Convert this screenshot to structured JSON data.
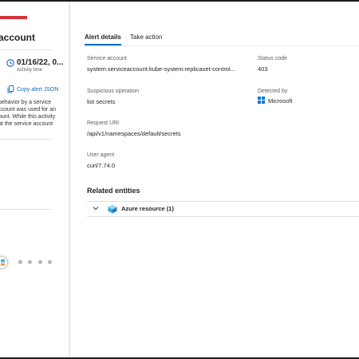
{
  "left_panel": {
    "title": "account",
    "activity_time": {
      "value": "01/16/22, 0...",
      "label": "Activity time"
    },
    "copy_alert_json": "Copy alert JSON",
    "description_lines": [
      "behavior by a service",
      "ccount was used for an",
      "ount. While this activity",
      "at the service account"
    ],
    "stepper": {
      "dots": 4
    }
  },
  "tabs": [
    {
      "label": "Alert details",
      "active": true
    },
    {
      "label": "Take action",
      "active": false
    }
  ],
  "details": {
    "service_account": {
      "label": "Service account",
      "value": "system:serviceaccount:kube-system:replicaset-control..."
    },
    "status_code": {
      "label": "Status code",
      "value": "403"
    },
    "suspicious_operation": {
      "label": "Suspicious operation",
      "value": "list secrets"
    },
    "detected_by": {
      "label": "Detected by",
      "value": "Microsoft"
    },
    "request_uri": {
      "label": "Request URI",
      "value": "/api/v1/namespaces/default/secrets"
    },
    "user_agent": {
      "label": "User agent",
      "value": "curl/7.74.0"
    }
  },
  "related_entities": {
    "title": "Related entities",
    "items": [
      {
        "label": "Azure resource (1)",
        "icon": "azure-resource-icon",
        "expanded": false
      }
    ]
  },
  "colors": {
    "accent": "#0f6cbd",
    "brand_red": "#d13438",
    "microsoft_blue": "#0078d4"
  }
}
